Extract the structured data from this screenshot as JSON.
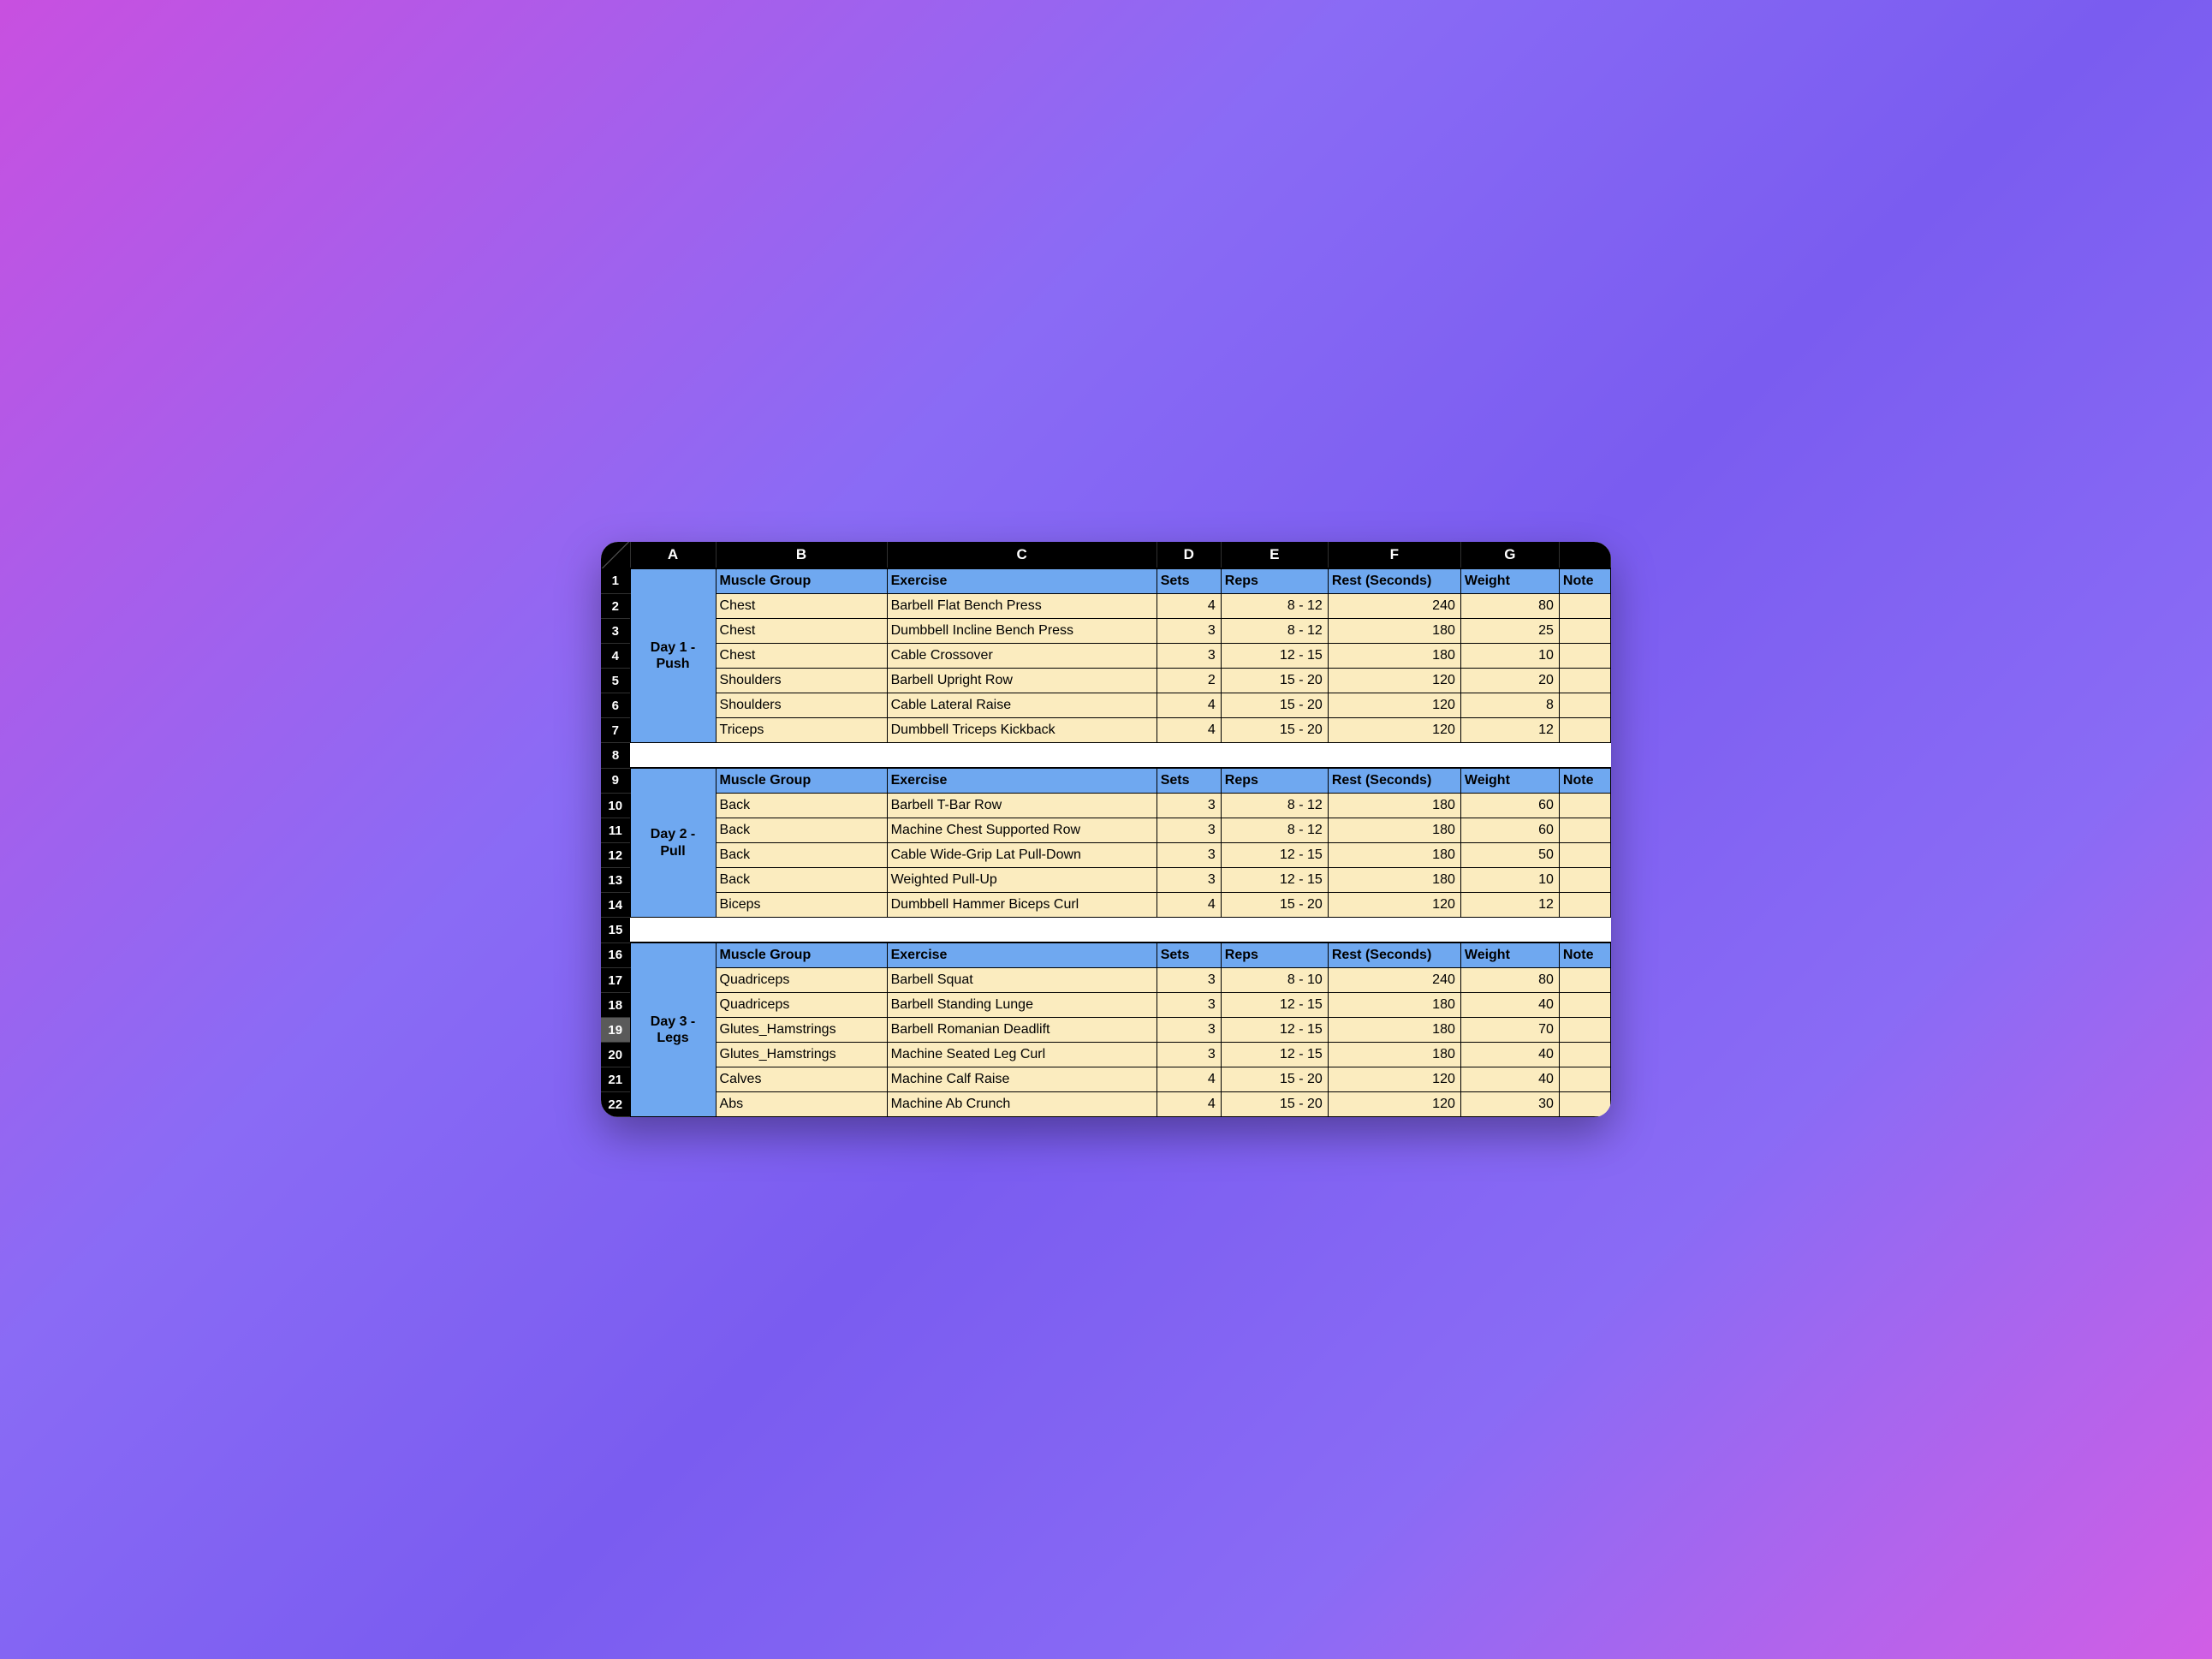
{
  "columns": [
    "A",
    "B",
    "C",
    "D",
    "E",
    "F",
    "G",
    ""
  ],
  "header_labels": {
    "muscle": "Muscle Group",
    "exercise": "Exercise",
    "sets": "Sets",
    "reps": "Reps",
    "rest": "Rest (Seconds)",
    "weight": "Weight",
    "note": "Note"
  },
  "blocks": [
    {
      "label": "Day 1 - Push",
      "rows": [
        {
          "muscle": "Chest",
          "exercise": "Barbell Flat Bench Press",
          "sets": "4",
          "reps": "8 - 12",
          "rest": "240",
          "weight": "80",
          "note": ""
        },
        {
          "muscle": "Chest",
          "exercise": "Dumbbell Incline Bench Press",
          "sets": "3",
          "reps": "8 - 12",
          "rest": "180",
          "weight": "25",
          "note": ""
        },
        {
          "muscle": "Chest",
          "exercise": "Cable Crossover",
          "sets": "3",
          "reps": "12 - 15",
          "rest": "180",
          "weight": "10",
          "note": ""
        },
        {
          "muscle": "Shoulders",
          "exercise": "Barbell Upright Row",
          "sets": "2",
          "reps": "15 - 20",
          "rest": "120",
          "weight": "20",
          "note": ""
        },
        {
          "muscle": "Shoulders",
          "exercise": "Cable Lateral Raise",
          "sets": "4",
          "reps": "15 - 20",
          "rest": "120",
          "weight": "8",
          "note": ""
        },
        {
          "muscle": "Triceps",
          "exercise": "Dumbbell Triceps Kickback",
          "sets": "4",
          "reps": "15 - 20",
          "rest": "120",
          "weight": "12",
          "note": ""
        }
      ]
    },
    {
      "label": "Day 2 - Pull",
      "rows": [
        {
          "muscle": "Back",
          "exercise": "Barbell T-Bar Row",
          "sets": "3",
          "reps": "8 - 12",
          "rest": "180",
          "weight": "60",
          "note": ""
        },
        {
          "muscle": "Back",
          "exercise": "Machine Chest Supported Row",
          "sets": "3",
          "reps": "8 - 12",
          "rest": "180",
          "weight": "60",
          "note": ""
        },
        {
          "muscle": "Back",
          "exercise": "Cable Wide-Grip Lat Pull-Down",
          "sets": "3",
          "reps": "12 - 15",
          "rest": "180",
          "weight": "50",
          "note": ""
        },
        {
          "muscle": "Back",
          "exercise": "Weighted Pull-Up",
          "sets": "3",
          "reps": "12 - 15",
          "rest": "180",
          "weight": "10",
          "note": ""
        },
        {
          "muscle": "Biceps",
          "exercise": "Dumbbell Hammer Biceps Curl",
          "sets": "4",
          "reps": "15 - 20",
          "rest": "120",
          "weight": "12",
          "note": ""
        }
      ]
    },
    {
      "label": "Day 3 - Legs",
      "rows": [
        {
          "muscle": "Quadriceps",
          "exercise": "Barbell Squat",
          "sets": "3",
          "reps": "8 - 10",
          "rest": "240",
          "weight": "80",
          "note": ""
        },
        {
          "muscle": "Quadriceps",
          "exercise": "Barbell Standing Lunge",
          "sets": "3",
          "reps": "12 - 15",
          "rest": "180",
          "weight": "40",
          "note": ""
        },
        {
          "muscle": "Glutes_Hamstrings",
          "exercise": "Barbell Romanian Deadlift",
          "sets": "3",
          "reps": "12 - 15",
          "rest": "180",
          "weight": "70",
          "note": ""
        },
        {
          "muscle": "Glutes_Hamstrings",
          "exercise": "Machine Seated Leg Curl",
          "sets": "3",
          "reps": "12 - 15",
          "rest": "180",
          "weight": "40",
          "note": ""
        },
        {
          "muscle": "Calves",
          "exercise": "Machine Calf Raise",
          "sets": "4",
          "reps": "15 - 20",
          "rest": "120",
          "weight": "40",
          "note": ""
        },
        {
          "muscle": "Abs",
          "exercise": "Machine Ab Crunch",
          "sets": "4",
          "reps": "15 - 20",
          "rest": "120",
          "weight": "30",
          "note": ""
        }
      ]
    }
  ],
  "selected_row": 19
}
